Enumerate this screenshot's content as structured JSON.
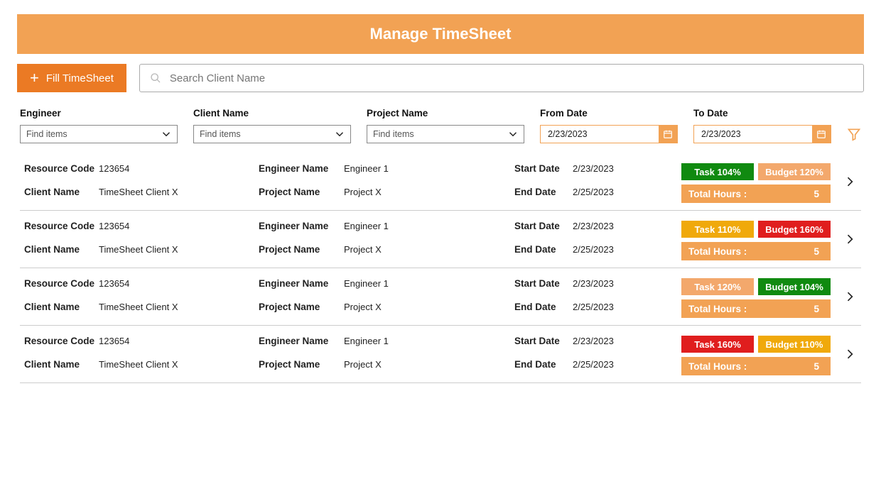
{
  "header": {
    "title": "Manage TimeSheet"
  },
  "actions": {
    "fill_label": "Fill TimeSheet"
  },
  "search": {
    "placeholder": "Search Client Name"
  },
  "filters": {
    "engineer_label": "Engineer",
    "client_label": "Client Name",
    "project_label": "Project Name",
    "find_placeholder": "Find items",
    "from_label": "From Date",
    "to_label": "To Date",
    "from_value": "2/23/2023",
    "to_value": "2/23/2023"
  },
  "row_labels": {
    "resource_code": "Resource Code",
    "client_name": "Client Name",
    "engineer_name": "Engineer Name",
    "project_name": "Project Name",
    "start_date": "Start Date",
    "end_date": "End Date",
    "total_hours": "Total Hours :"
  },
  "colors": {
    "green": "#108a10",
    "lightorange": "#f3a86c",
    "gold": "#f0a90b",
    "red": "#e01e1e"
  },
  "rows": [
    {
      "resource_code": "123654",
      "client_name": "TimeSheet Client X",
      "engineer_name": "Engineer 1",
      "project_name": "Project X",
      "start_date": "2/23/2023",
      "end_date": "2/25/2023",
      "task": {
        "label": "Task 104%",
        "color": "green"
      },
      "budget": {
        "label": "Budget 120%",
        "color": "lightorange"
      },
      "total_hours": "5"
    },
    {
      "resource_code": "123654",
      "client_name": "TimeSheet Client X",
      "engineer_name": "Engineer 1",
      "project_name": "Project X",
      "start_date": "2/23/2023",
      "end_date": "2/25/2023",
      "task": {
        "label": "Task 110%",
        "color": "gold"
      },
      "budget": {
        "label": "Budget 160%",
        "color": "red"
      },
      "total_hours": "5"
    },
    {
      "resource_code": "123654",
      "client_name": "TimeSheet Client X",
      "engineer_name": "Engineer 1",
      "project_name": "Project X",
      "start_date": "2/23/2023",
      "end_date": "2/25/2023",
      "task": {
        "label": "Task 120%",
        "color": "lightorange"
      },
      "budget": {
        "label": "Budget 104%",
        "color": "green"
      },
      "total_hours": "5"
    },
    {
      "resource_code": "123654",
      "client_name": "TimeSheet Client X",
      "engineer_name": "Engineer 1",
      "project_name": "Project X",
      "start_date": "2/23/2023",
      "end_date": "2/25/2023",
      "task": {
        "label": "Task 160%",
        "color": "red"
      },
      "budget": {
        "label": "Budget 110%",
        "color": "gold"
      },
      "total_hours": "5"
    }
  ]
}
